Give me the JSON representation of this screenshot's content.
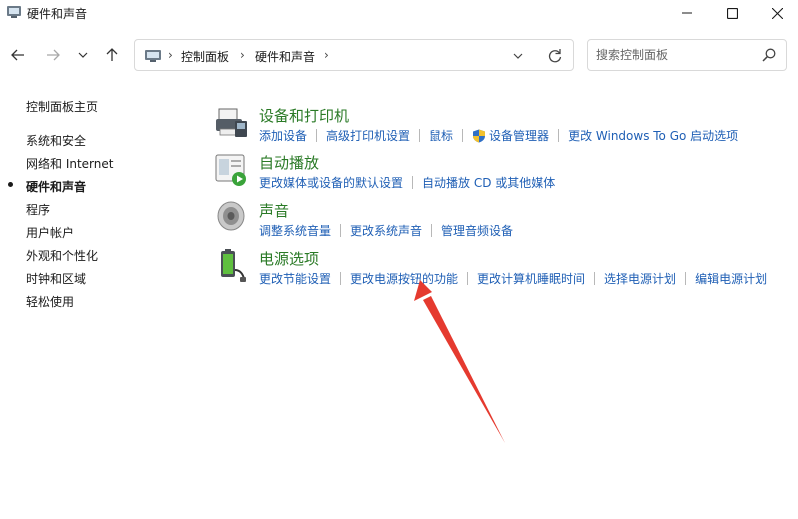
{
  "window": {
    "title": "硬件和声音"
  },
  "nav": {
    "breadcrumbs": [
      "控制面板",
      "硬件和声音"
    ]
  },
  "search": {
    "placeholder": "搜索控制面板"
  },
  "sidebar": {
    "home": "控制面板主页",
    "items": [
      {
        "label": "系统和安全"
      },
      {
        "label": "网络和 Internet"
      },
      {
        "label": "硬件和声音",
        "current": true
      },
      {
        "label": "程序"
      },
      {
        "label": "用户帐户"
      },
      {
        "label": "外观和个性化"
      },
      {
        "label": "时钟和区域"
      },
      {
        "label": "轻松使用"
      }
    ]
  },
  "categories": [
    {
      "title": "设备和打印机",
      "icon": "printer-icon",
      "links": [
        "添加设备",
        "高级打印机设置",
        "鼠标",
        "设备管理器",
        "更改 Windows To Go 启动选项"
      ]
    },
    {
      "title": "自动播放",
      "icon": "autoplay-icon",
      "links": [
        "更改媒体或设备的默认设置",
        "自动播放 CD 或其他媒体"
      ]
    },
    {
      "title": "声音",
      "icon": "speaker-icon",
      "links": [
        "调整系统音量",
        "更改系统声音",
        "管理音频设备"
      ]
    },
    {
      "title": "电源选项",
      "icon": "power-options-icon",
      "links": [
        "更改节能设置",
        "更改电源按钮的功能",
        "更改计算机睡眠时间",
        "选择电源计划",
        "编辑电源计划"
      ]
    }
  ],
  "colors": {
    "category_title": "#2a7a26",
    "link": "#1f5fb5",
    "annotation_arrow": "#e53a2f"
  }
}
